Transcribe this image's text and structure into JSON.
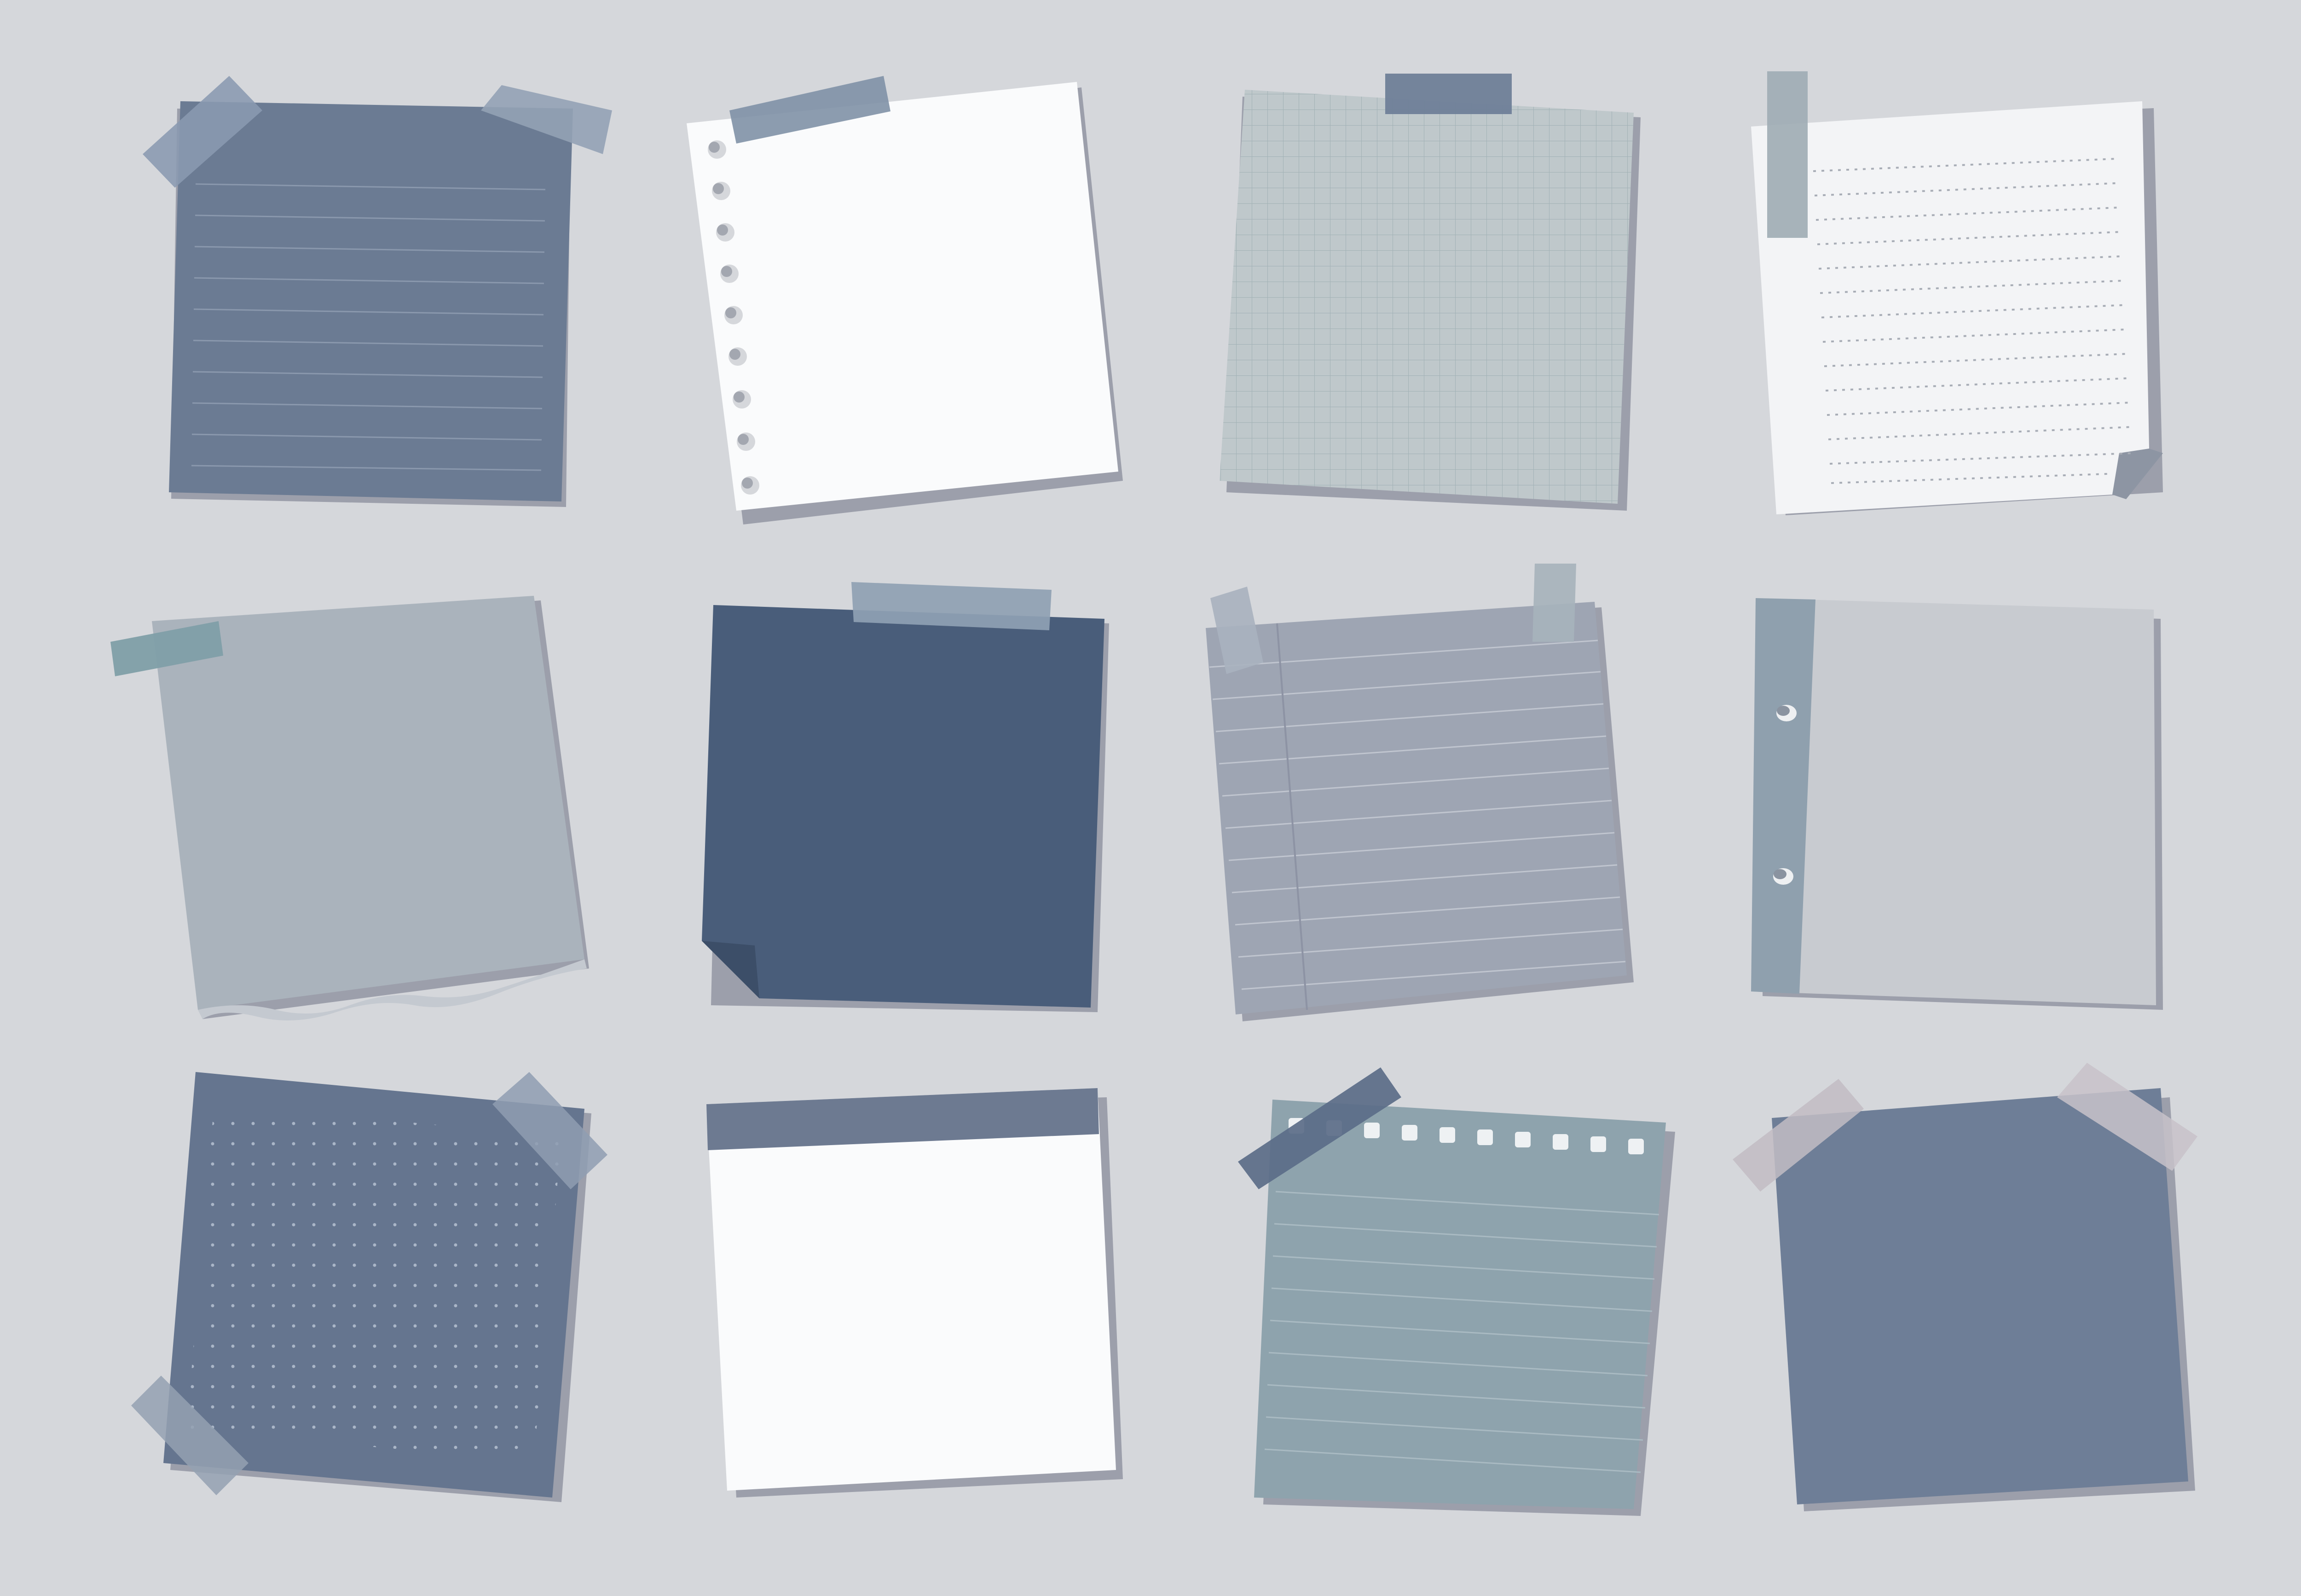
{
  "palette": {
    "background": "#d5d7db",
    "shadow": "#9c9fab",
    "slate_blue": "#6b7b93",
    "navy": "#495d7a",
    "white": "#fafbfc",
    "grid_grey": "#bfc8cb",
    "light_grey": "#aab3bc",
    "lavender_grey": "#9ea5b3",
    "pale_grey": "#c8cbd0",
    "teal_grey": "#8ea3ad",
    "tape_slate": "#8a9ab0",
    "tape_teal": "#7f9fa8",
    "tape_pink": "#c2bcc3"
  },
  "notes": [
    {
      "style": "lined",
      "paper_color": "#6b7b93",
      "tapes": 2
    },
    {
      "style": "punched-holes-left",
      "paper_color": "#fafbfc",
      "tapes": 1
    },
    {
      "style": "grid",
      "paper_color": "#bfc8cb",
      "tapes": 1
    },
    {
      "style": "dotted-lines",
      "paper_color": "#f3f4f6",
      "tapes": 1,
      "folded_corner": true
    },
    {
      "style": "torn-bottom",
      "paper_color": "#aab3bc",
      "tapes": 1
    },
    {
      "style": "plain-sticky",
      "paper_color": "#495d7a",
      "tapes": 1,
      "folded_corner": true
    },
    {
      "style": "ruled-margin",
      "paper_color": "#9ea5b3",
      "tapes": 2
    },
    {
      "style": "binder-strip",
      "paper_color": "#c8cbd0",
      "tapes": 0
    },
    {
      "style": "dot-grid",
      "paper_color": "#65758f",
      "tapes": 2
    },
    {
      "style": "header-bar",
      "paper_color": "#fafbfc",
      "tapes": 0
    },
    {
      "style": "spiral-lined",
      "paper_color": "#8ea3ad",
      "tapes": 1
    },
    {
      "style": "plain",
      "paper_color": "#6e7e97",
      "tapes": 2
    }
  ]
}
